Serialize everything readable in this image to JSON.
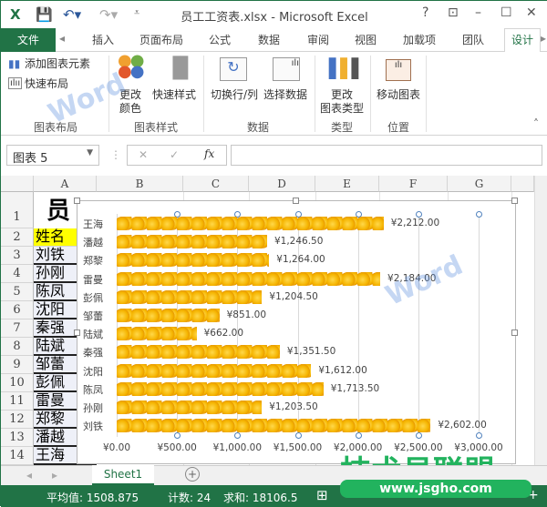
{
  "window": {
    "title": "员工工资表.xlsx - Microsoft Excel",
    "help": "?",
    "minimize": "–",
    "maximize": "☐",
    "close": "✕"
  },
  "tabs": {
    "file": "文件",
    "items": [
      "插入",
      "页面布局",
      "公式",
      "数据",
      "审阅",
      "视图",
      "加载项",
      "团队"
    ],
    "active": "设计"
  },
  "ribbon": {
    "add_element": "添加图表元素",
    "quick_layout": "快速布局",
    "change_color_1": "更改",
    "change_color_2": "颜色",
    "quick_style": "快速样式",
    "switch_row_col": "切换行/列",
    "select_data": "选择数据",
    "change_type_1": "更改",
    "change_type_2": "图表类型",
    "move_chart": "移动图表",
    "groups": [
      "图表布局",
      "图表样式",
      "数据",
      "类型",
      "位置"
    ]
  },
  "formula_bar": {
    "name_box": "图表 5",
    "fx": "fx",
    "value": ""
  },
  "sheet": {
    "columns": [
      "A",
      "B",
      "C",
      "D",
      "E",
      "F",
      "G"
    ],
    "rows": [
      "1",
      "2",
      "3",
      "4",
      "5",
      "6",
      "7",
      "8",
      "9",
      "10",
      "11",
      "12",
      "13",
      "14"
    ],
    "title": "员",
    "col_a": [
      "姓名",
      "刘铁",
      "孙刚",
      "陈凤",
      "沈阳",
      "秦强",
      "陆斌",
      "邹蕾",
      "彭佩",
      "雷曼",
      "郑黎",
      "潘越",
      "王海"
    ],
    "header_color": "#ffff00"
  },
  "chart_data": {
    "type": "bar",
    "orientation": "horizontal",
    "categories": [
      "王海",
      "潘越",
      "郑黎",
      "雷曼",
      "彭佩",
      "邹蕾",
      "陆斌",
      "秦强",
      "沈阳",
      "陈凤",
      "孙刚",
      "刘铁"
    ],
    "values": [
      2212,
      1246.5,
      1264,
      2184,
      1204.5,
      851,
      662,
      1351.5,
      1612,
      1713.5,
      1203.5,
      2602
    ],
    "data_labels": [
      "¥2,212.00",
      "¥1,246.50",
      "¥1,264.00",
      "¥2,184.00",
      "¥1,204.50",
      "¥851.00",
      "¥662.00",
      "¥1,351.50",
      "¥1,612.00",
      "¥1,713.50",
      "¥1,203.50",
      "¥2,602.00"
    ],
    "xlim": [
      0,
      3000
    ],
    "xticks": [
      "¥0.00",
      "¥500.00",
      "¥1,000.00",
      "¥1,500.00",
      "¥2,000.00",
      "¥2,500.00",
      "¥3,000.00"
    ],
    "fill": "coin pictures",
    "bar_color": "#f5b400"
  },
  "sheet_tabs": {
    "active": "Sheet1",
    "add": "+"
  },
  "status": {
    "average": "平均值: 1508.875",
    "count": "计数: 24",
    "sum": "求和: 18106.5"
  },
  "watermarks": {
    "brand": "Word联盟",
    "site": "技术员联盟",
    "url": "www.jsgho.com"
  }
}
